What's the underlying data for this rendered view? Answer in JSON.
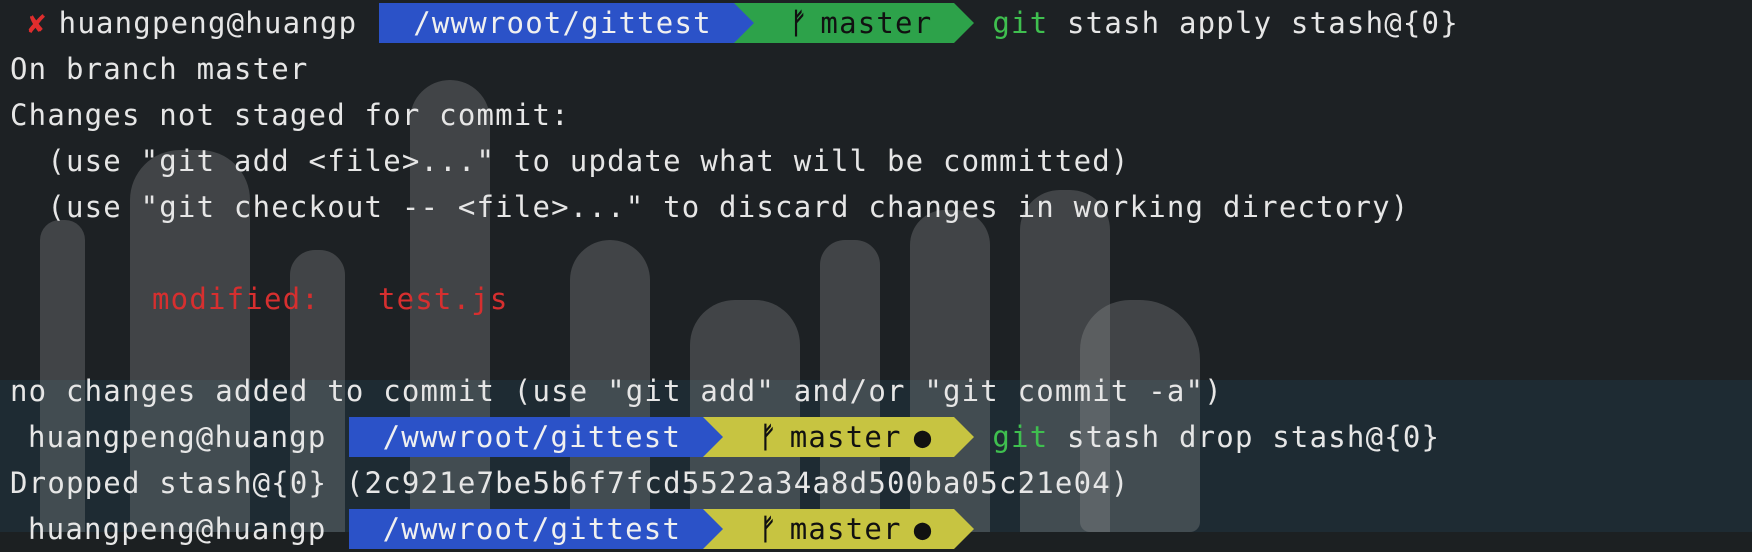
{
  "prompts": [
    {
      "status_icon": "✘",
      "user_host": "huangpeng@huangp",
      "path": "/wwwroot/gittest",
      "branch_icon": "ᚠ",
      "branch": "master",
      "dirty_marker": "",
      "command_bin": "git",
      "command_args": " stash apply stash@{0}",
      "state": "clean"
    },
    {
      "status_icon": "",
      "user_host": "huangpeng@huangp",
      "path": "/wwwroot/gittest",
      "branch_icon": "ᚠ",
      "branch": "master",
      "dirty_marker": "●",
      "command_bin": "git",
      "command_args": " stash drop stash@{0}",
      "state": "dirty"
    },
    {
      "status_icon": "",
      "user_host": "huangpeng@huangp",
      "path": "/wwwroot/gittest",
      "branch_icon": "ᚠ",
      "branch": "master",
      "dirty_marker": "●",
      "command_bin": "",
      "command_args": "",
      "state": "dirty"
    }
  ],
  "output": {
    "on_branch": "On branch master",
    "changes_header": "Changes not staged for commit:",
    "hint_add": "  (use \"git add <file>...\" to update what will be committed)",
    "hint_checkout": "  (use \"git checkout -- <file>...\" to discard changes in working directory)",
    "modified_label": "modified:",
    "modified_file": "test.js",
    "no_changes": "no changes added to commit (use \"git add\" and/or \"git commit -a\")",
    "dropped": "Dropped stash@{0} (2c921e7be5b6f7fcd5522a34a8d500ba05c21e04)"
  },
  "colors": {
    "background": "#1c2022",
    "path_segment": "#2b52c8",
    "git_clean": "#2da24a",
    "git_dirty": "#c7c441",
    "error": "#d62f2f",
    "git_command": "#3fbf4f"
  }
}
